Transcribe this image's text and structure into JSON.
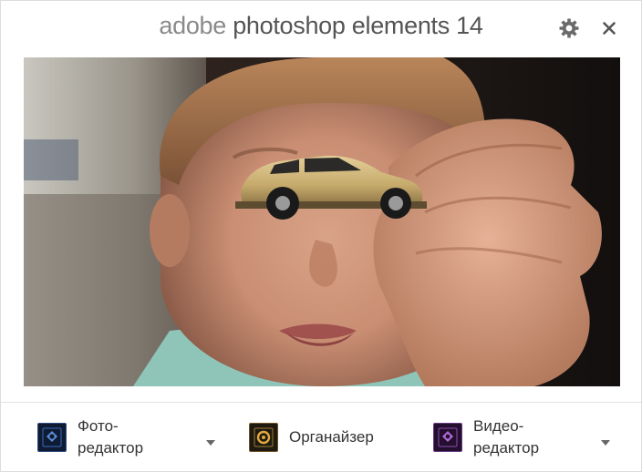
{
  "window": {
    "title_brand": "adobe",
    "title_product": "photoshop elements 14",
    "settings_icon": "gear-icon",
    "close_icon": "close-icon"
  },
  "hero": {
    "description_icon": "welcome-photo"
  },
  "launchers": [
    {
      "line1": "Фото-",
      "line2": "редактор",
      "icon": "photo-editor-icon",
      "accent": "#5a8fd8",
      "bg": "#0f1a33",
      "has_dropdown": true
    },
    {
      "line1": "Органайзер",
      "line2": "",
      "icon": "organizer-icon",
      "accent": "#e2a83a",
      "bg": "#1e1a12",
      "has_dropdown": false
    },
    {
      "line1": "Видео-",
      "line2": "редактор",
      "icon": "video-editor-icon",
      "accent": "#b06ad8",
      "bg": "#24102e",
      "has_dropdown": true
    }
  ],
  "colors": {
    "title_text": "#555555",
    "brand_text": "#8a8a8a",
    "icon_gray": "#666666"
  }
}
